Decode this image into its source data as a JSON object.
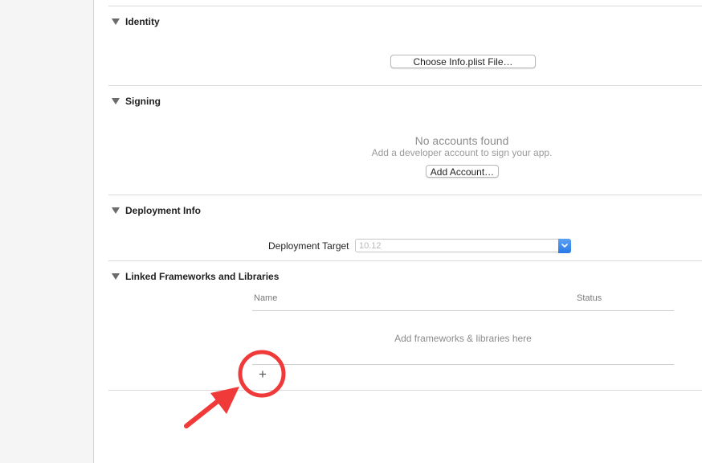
{
  "sections": {
    "identity": {
      "title": "Identity",
      "choose_plist_label": "Choose Info.plist File…"
    },
    "signing": {
      "title": "Signing",
      "empty_title": "No accounts found",
      "empty_subtitle": "Add a developer account to sign your app.",
      "add_account_label": "Add Account…"
    },
    "deployment": {
      "title": "Deployment Info",
      "target_label": "Deployment Target",
      "target_value": "10.12"
    },
    "frameworks": {
      "title": "Linked Frameworks and Libraries",
      "columns": [
        "Name",
        "Status"
      ],
      "empty_text": "Add frameworks & libraries here",
      "add_label": "+"
    }
  },
  "colors": {
    "annotation": "#f03a3a",
    "select_accent": "#2a78e6"
  },
  "icons": {
    "disclosure": "disclosure-triangle-icon",
    "select": "popup-chevron-icon",
    "annotation": "highlight-circle-arrow-icon"
  }
}
